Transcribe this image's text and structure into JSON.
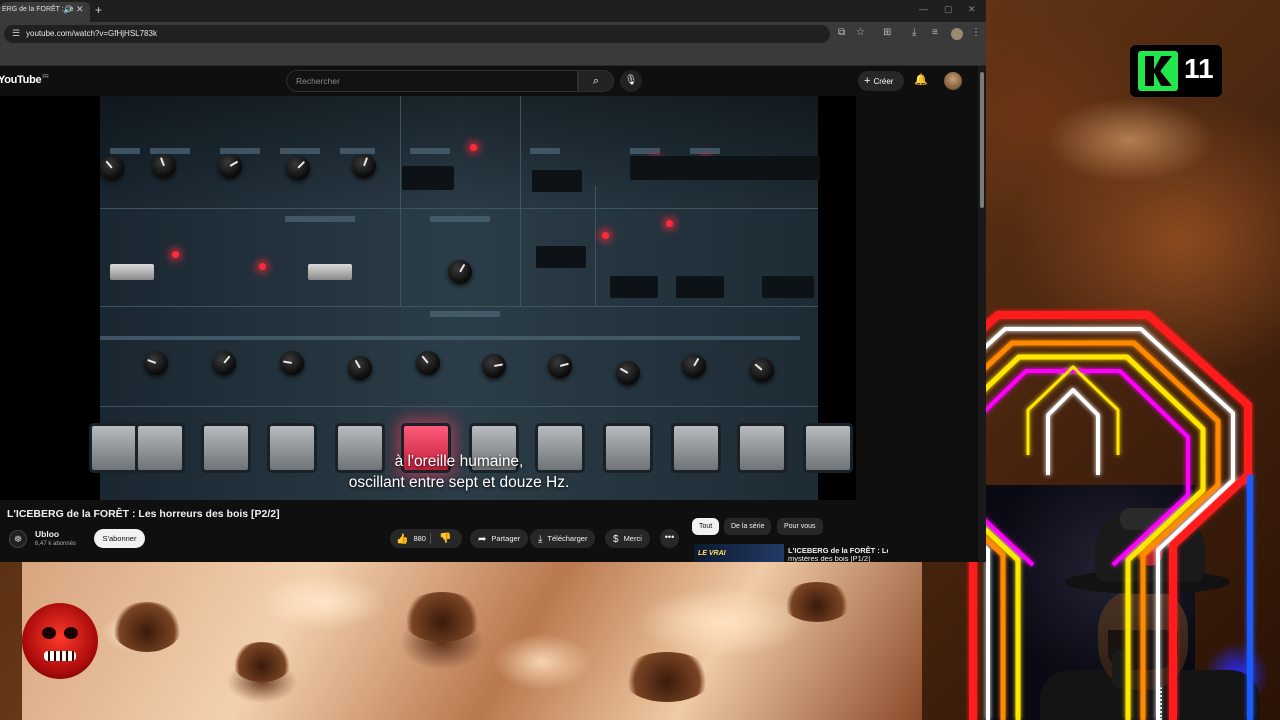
{
  "browser": {
    "tab_title": "ERG de la FORÊT : Le",
    "url": "youtube.com/watch?v=GfHjHSL783k"
  },
  "youtube": {
    "logo": "YouTube",
    "region": "FR",
    "search_placeholder": "Rechercher",
    "create_label": "Créer"
  },
  "video": {
    "subtitle_lines": [
      "à l'oreille humaine,",
      "oscillant entre sept et douze Hz."
    ],
    "title": "L'ICEBERG de la FORÊT : Les horreurs des bois [P2/2]",
    "channel": "Ubloo",
    "subscribers": "6,47 k abonnés",
    "subscribe_label": "S'abonner",
    "likes": "880",
    "share_label": "Partager",
    "download_label": "Télécharger",
    "thanks_label": "Merci"
  },
  "recommendations": {
    "chips": [
      "Tout",
      "De la série",
      "Pour vous"
    ],
    "items": [
      {
        "thumb_text": "LE VRAI",
        "title": "L'ICEBERG de la FORÊT : Les",
        "title_cont": "mystères des bois [P1/2]"
      }
    ]
  },
  "overlay": {
    "badge_number": "11"
  },
  "colors": {
    "youtube_bg": "#0f0f0f",
    "badge_green": "#22e64b",
    "led_red": "#ff2a3a"
  }
}
